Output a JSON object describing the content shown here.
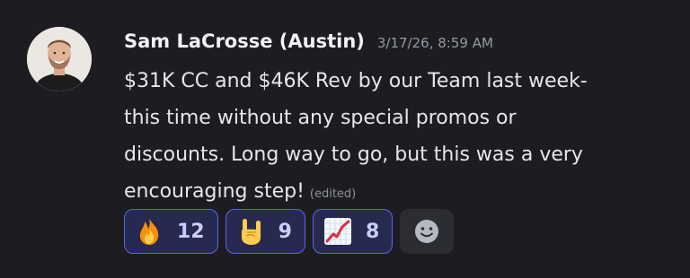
{
  "message": {
    "author": "Sam LaCrosse (Austin)",
    "timestamp": "3/17/26, 8:59 AM",
    "lines": [
      "$31K CC and $46K Rev by our Team last week-",
      "this time without any special promos or",
      "discounts. Long way to go, but this was a very",
      "encouraging step!"
    ],
    "edited_label": "(edited)"
  },
  "reactions": [
    {
      "icon": "fire-emoji",
      "count": "12"
    },
    {
      "icon": "sign-of-the-horns-emoji",
      "count": "9"
    },
    {
      "icon": "chart-increasing-emoji",
      "count": "8"
    }
  ],
  "add_reaction": {
    "icon": "smiley-face-icon"
  },
  "colors": {
    "background": "#1c1c21",
    "reaction_border": "#5865f2",
    "reaction_fill": "#272a4f",
    "reaction_count": "#c9cdfb",
    "author": "#f2f3f5",
    "timestamp": "#949ba4"
  }
}
